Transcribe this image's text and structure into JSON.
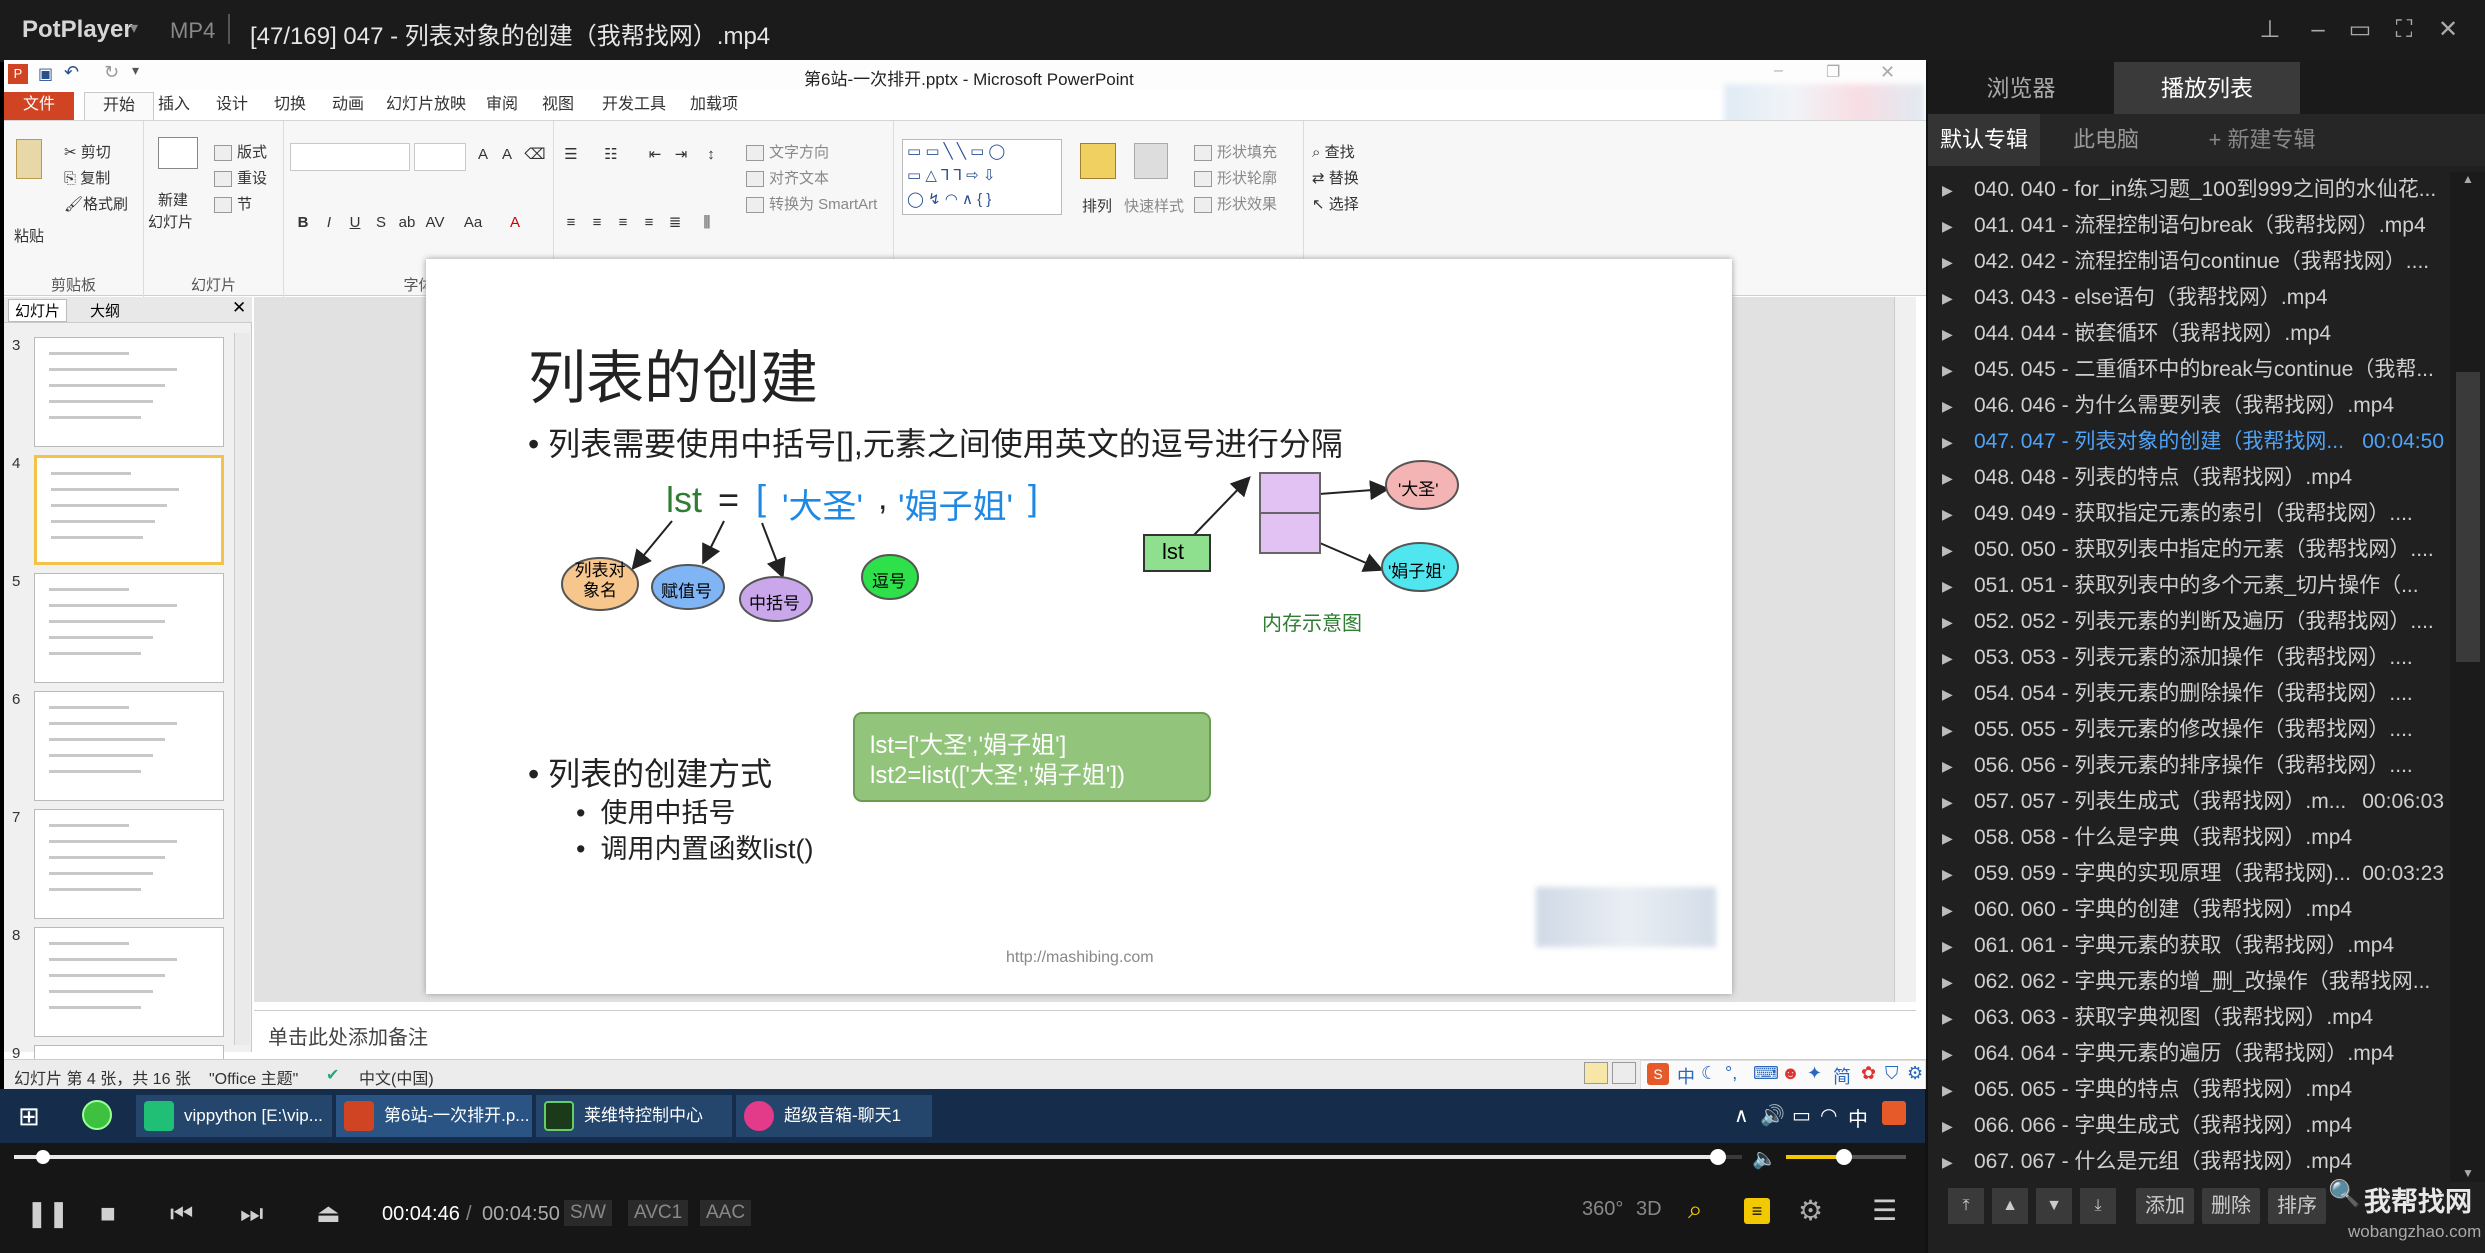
{
  "player": {
    "app_name": "PotPlayer",
    "format": "MP4",
    "file_title": "[47/169] 047 - 列表对象的创建（我帮找网）.mp4",
    "time_current": "00:04:46",
    "time_separator": "/",
    "time_total": "00:04:50",
    "progress_fraction": 0.986,
    "badges": [
      "S/W",
      "AVC1",
      "AAC"
    ],
    "icon_labels": [
      "360°",
      "3D"
    ]
  },
  "ppt": {
    "window_title": "第6站-一次排开.pptx - Microsoft PowerPoint",
    "tabs": [
      "文件",
      "开始",
      "插入",
      "设计",
      "切换",
      "动画",
      "幻灯片放映",
      "审阅",
      "视图",
      "开发工具",
      "加载项"
    ],
    "active_tab": "开始",
    "ribbon": {
      "clipboard": {
        "paste": "粘贴",
        "cut": "剪切",
        "copy": "复制",
        "format_painter": "格式刷",
        "label": "剪贴板"
      },
      "slides": {
        "new_slide": "新建",
        "new_slide2": "幻灯片",
        "layout": "版式",
        "reset": "重设",
        "section": "节",
        "label": "幻灯片"
      },
      "font_label": "字体",
      "paragraph": {
        "text_direction": "文字方向",
        "align_text": "对齐文本",
        "smartart": "转换为 SmartArt",
        "label": "段落"
      },
      "drawing": {
        "arrange": "排列",
        "quick_styles": "快速样式",
        "fill": "形状填充",
        "outline": "形状轮廓",
        "effects": "形状效果",
        "label": "绘图"
      },
      "editing": {
        "find": "查找",
        "replace": "替换",
        "select": "选择",
        "label": "编辑"
      }
    },
    "pane_tabs": [
      "幻灯片",
      "大纲"
    ],
    "thumb_numbers": [
      "3",
      "4",
      "5",
      "6",
      "7",
      "8",
      "9"
    ],
    "notes_placeholder": "单击此处添加备注",
    "status": {
      "slide_info": "幻灯片 第 4 张，共 16 张",
      "theme": "\"Office 主题\"",
      "language": "中文(中国)"
    },
    "ime": "中"
  },
  "slide": {
    "title": "列表的创建",
    "bullet1": "列表需要使用中括号[],元素之间使用英文的逗号进行分隔",
    "code_lst": "lst",
    "code_eq": "=",
    "code_open": "[",
    "code_item1": "'大圣'",
    "code_comma": ",",
    "code_item2": "'娟子姐'",
    "code_close": "]",
    "cloud_name": "列表对\n象名",
    "cloud_assign": "赋值号",
    "cloud_bracket": "中括号",
    "cloud_comma": "逗号",
    "mem_var": "lst",
    "mem_item1": "'大圣'",
    "mem_item2": "'娟子姐'",
    "mem_caption": "内存示意图",
    "bullet2": "列表的创建方式",
    "sub1": "使用中括号",
    "sub2": "调用内置函数list()",
    "code_box_line1": "lst=['大圣','娟子姐']",
    "code_box_line2": "lst2=list(['大圣','娟子姐'])",
    "footer_url": "http://mashibing.com"
  },
  "taskbar": {
    "items": [
      "vippython [E:\\vip...",
      "第6站-一次排开.p...",
      "莱维特控制中心",
      "超级音箱-聊天1"
    ],
    "ime_char": "中"
  },
  "playlist": {
    "tabs": [
      "浏览器",
      "播放列表"
    ],
    "active_tab": "播放列表",
    "subtabs": [
      "默认专辑",
      "此电脑",
      "+ 新建专辑"
    ],
    "items": [
      {
        "title": "040. 040 - for_in练习题_100到999之间的水仙花...",
        "dur": ""
      },
      {
        "title": "041. 041 - 流程控制语句break（我帮找网）.mp4",
        "dur": ""
      },
      {
        "title": "042. 042 - 流程控制语句continue（我帮找网）....",
        "dur": ""
      },
      {
        "title": "043. 043 - else语句（我帮找网）.mp4",
        "dur": ""
      },
      {
        "title": "044. 044 - 嵌套循环（我帮找网）.mp4",
        "dur": ""
      },
      {
        "title": "045. 045 - 二重循环中的break与continue（我帮...",
        "dur": ""
      },
      {
        "title": "046. 046 - 为什么需要列表（我帮找网）.mp4",
        "dur": ""
      },
      {
        "title": "047. 047 - 列表对象的创建（我帮找网...",
        "dur": "00:04:50",
        "current": true
      },
      {
        "title": "048. 048 - 列表的特点（我帮找网）.mp4",
        "dur": ""
      },
      {
        "title": "049. 049 - 获取指定元素的索引（我帮找网）....",
        "dur": ""
      },
      {
        "title": "050. 050 - 获取列表中指定的元素（我帮找网）....",
        "dur": ""
      },
      {
        "title": "051. 051 - 获取列表中的多个元素_切片操作（...",
        "dur": ""
      },
      {
        "title": "052. 052 - 列表元素的判断及遍历（我帮找网）....",
        "dur": ""
      },
      {
        "title": "053. 053 - 列表元素的添加操作（我帮找网）....",
        "dur": ""
      },
      {
        "title": "054. 054 - 列表元素的删除操作（我帮找网）....",
        "dur": ""
      },
      {
        "title": "055. 055 - 列表元素的修改操作（我帮找网）....",
        "dur": ""
      },
      {
        "title": "056. 056 - 列表元素的排序操作（我帮找网）....",
        "dur": ""
      },
      {
        "title": "057. 057 - 列表生成式（我帮找网）.m...",
        "dur": "00:06:03"
      },
      {
        "title": "058. 058 - 什么是字典（我帮找网）.mp4",
        "dur": ""
      },
      {
        "title": "059. 059 - 字典的实现原理（我帮找网)...",
        "dur": "00:03:23"
      },
      {
        "title": "060. 060 - 字典的创建（我帮找网）.mp4",
        "dur": ""
      },
      {
        "title": "061. 061 - 字典元素的获取（我帮找网）.mp4",
        "dur": ""
      },
      {
        "title": "062. 062 - 字典元素的增_删_改操作（我帮找网...",
        "dur": ""
      },
      {
        "title": "063. 063 - 获取字典视图（我帮找网）.mp4",
        "dur": ""
      },
      {
        "title": "064. 064 - 字典元素的遍历（我帮找网）.mp4",
        "dur": ""
      },
      {
        "title": "065. 065 - 字典的特点（我帮找网）.mp4",
        "dur": ""
      },
      {
        "title": "066. 066 - 字典生成式（我帮找网）.mp4",
        "dur": ""
      },
      {
        "title": "067. 067 - 什么是元组（我帮找网）.mp4",
        "dur": ""
      }
    ],
    "buttons": [
      "添加",
      "删除",
      "排序"
    ],
    "watermark": "我帮找网",
    "watermark_url": "wobangzhao.com"
  }
}
